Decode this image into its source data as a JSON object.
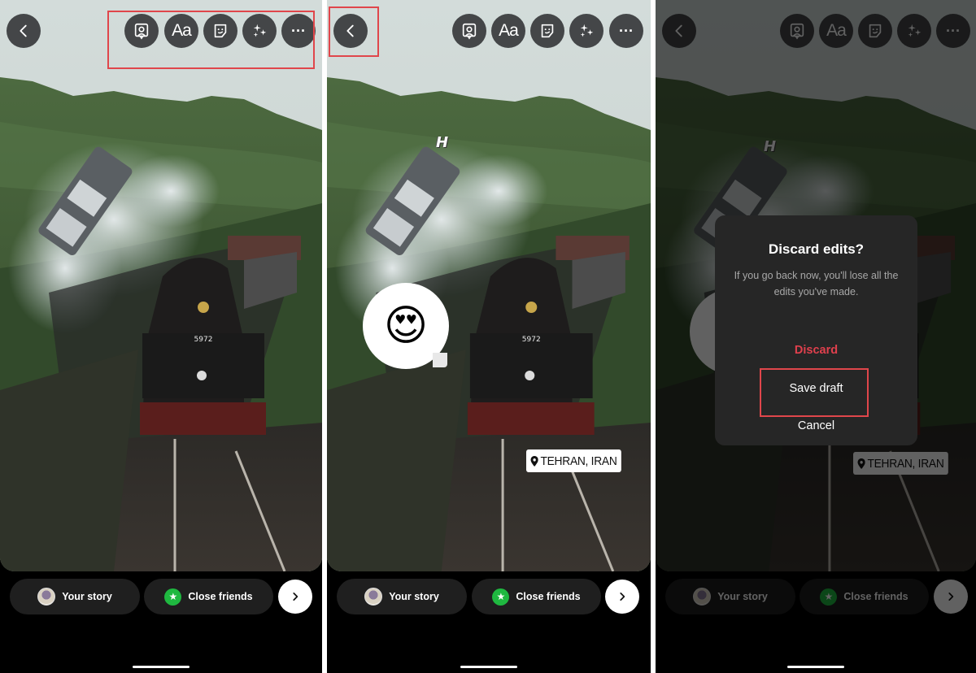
{
  "panels": [
    {
      "id": "editor-initial",
      "toolbar": {
        "back_icon": "chevron-left-icon",
        "tools": [
          {
            "name": "mention-icon"
          },
          {
            "name": "text-icon",
            "label": "Aa"
          },
          {
            "name": "sticker-icon"
          },
          {
            "name": "effects-sparkle-icon"
          },
          {
            "name": "more-icon",
            "label": "···"
          }
        ]
      },
      "share_bar": {
        "your_story": "Your story",
        "close_friends": "Close friends",
        "next_icon": "chevron-right-icon"
      },
      "annotation": "toolbar highlighted"
    },
    {
      "id": "editor-with-stickers",
      "toolbar": {
        "back_icon": "chevron-left-icon",
        "tools": [
          {
            "name": "mention-icon"
          },
          {
            "name": "text-icon",
            "label": "Aa"
          },
          {
            "name": "sticker-icon"
          },
          {
            "name": "effects-sparkle-icon"
          },
          {
            "name": "more-icon",
            "label": "···"
          }
        ]
      },
      "stickers": {
        "text": "H",
        "emoji": "😍",
        "location": "TEHRAN, IRAN"
      },
      "share_bar": {
        "your_story": "Your story",
        "close_friends": "Close friends",
        "next_icon": "chevron-right-icon"
      },
      "annotation": "back button highlighted"
    },
    {
      "id": "discard-dialog",
      "stickers": {
        "text": "H",
        "location": "TEHRAN, IRAN"
      },
      "dialog": {
        "title": "Discard edits?",
        "message": "If you go back now, you'll lose all the edits you've made.",
        "discard": "Discard",
        "save_draft": "Save draft",
        "cancel": "Cancel"
      },
      "share_bar": {
        "your_story": "Your story",
        "close_friends": "Close friends",
        "next_icon": "chevron-right-icon"
      },
      "annotation": "save draft highlighted"
    }
  ],
  "colors": {
    "highlight": "#e0464b",
    "discard": "#e0404d",
    "close_friends_green": "#1fb840",
    "dialog_bg": "#262626",
    "pill_bg": "#1f1f1f"
  },
  "photo": {
    "subject": "steam train on viaduct with flying car",
    "engine_number": "5972"
  }
}
